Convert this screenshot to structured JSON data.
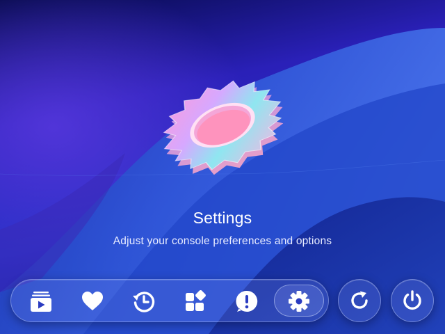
{
  "screen": {
    "title": "Settings",
    "subtitle": "Adjust your console preferences and options",
    "hero_icon": "gear-icon"
  },
  "dock": {
    "items": [
      {
        "id": "media",
        "icon": "media-library-icon",
        "active": false
      },
      {
        "id": "favorites",
        "icon": "heart-icon",
        "active": false
      },
      {
        "id": "history",
        "icon": "history-icon",
        "active": false
      },
      {
        "id": "apps",
        "icon": "apps-grid-icon",
        "active": false
      },
      {
        "id": "notifications",
        "icon": "alert-icon",
        "active": false
      },
      {
        "id": "settings",
        "icon": "gear-icon",
        "active": true
      }
    ]
  },
  "controls": {
    "refresh_icon": "refresh-icon",
    "power_icon": "power-icon"
  },
  "colors": {
    "background_top": "#0a0f5e",
    "background_mid": "#2730c6",
    "wave_light": "#3f63e0",
    "icon": "#ffffff",
    "glass": "#96aaff"
  }
}
